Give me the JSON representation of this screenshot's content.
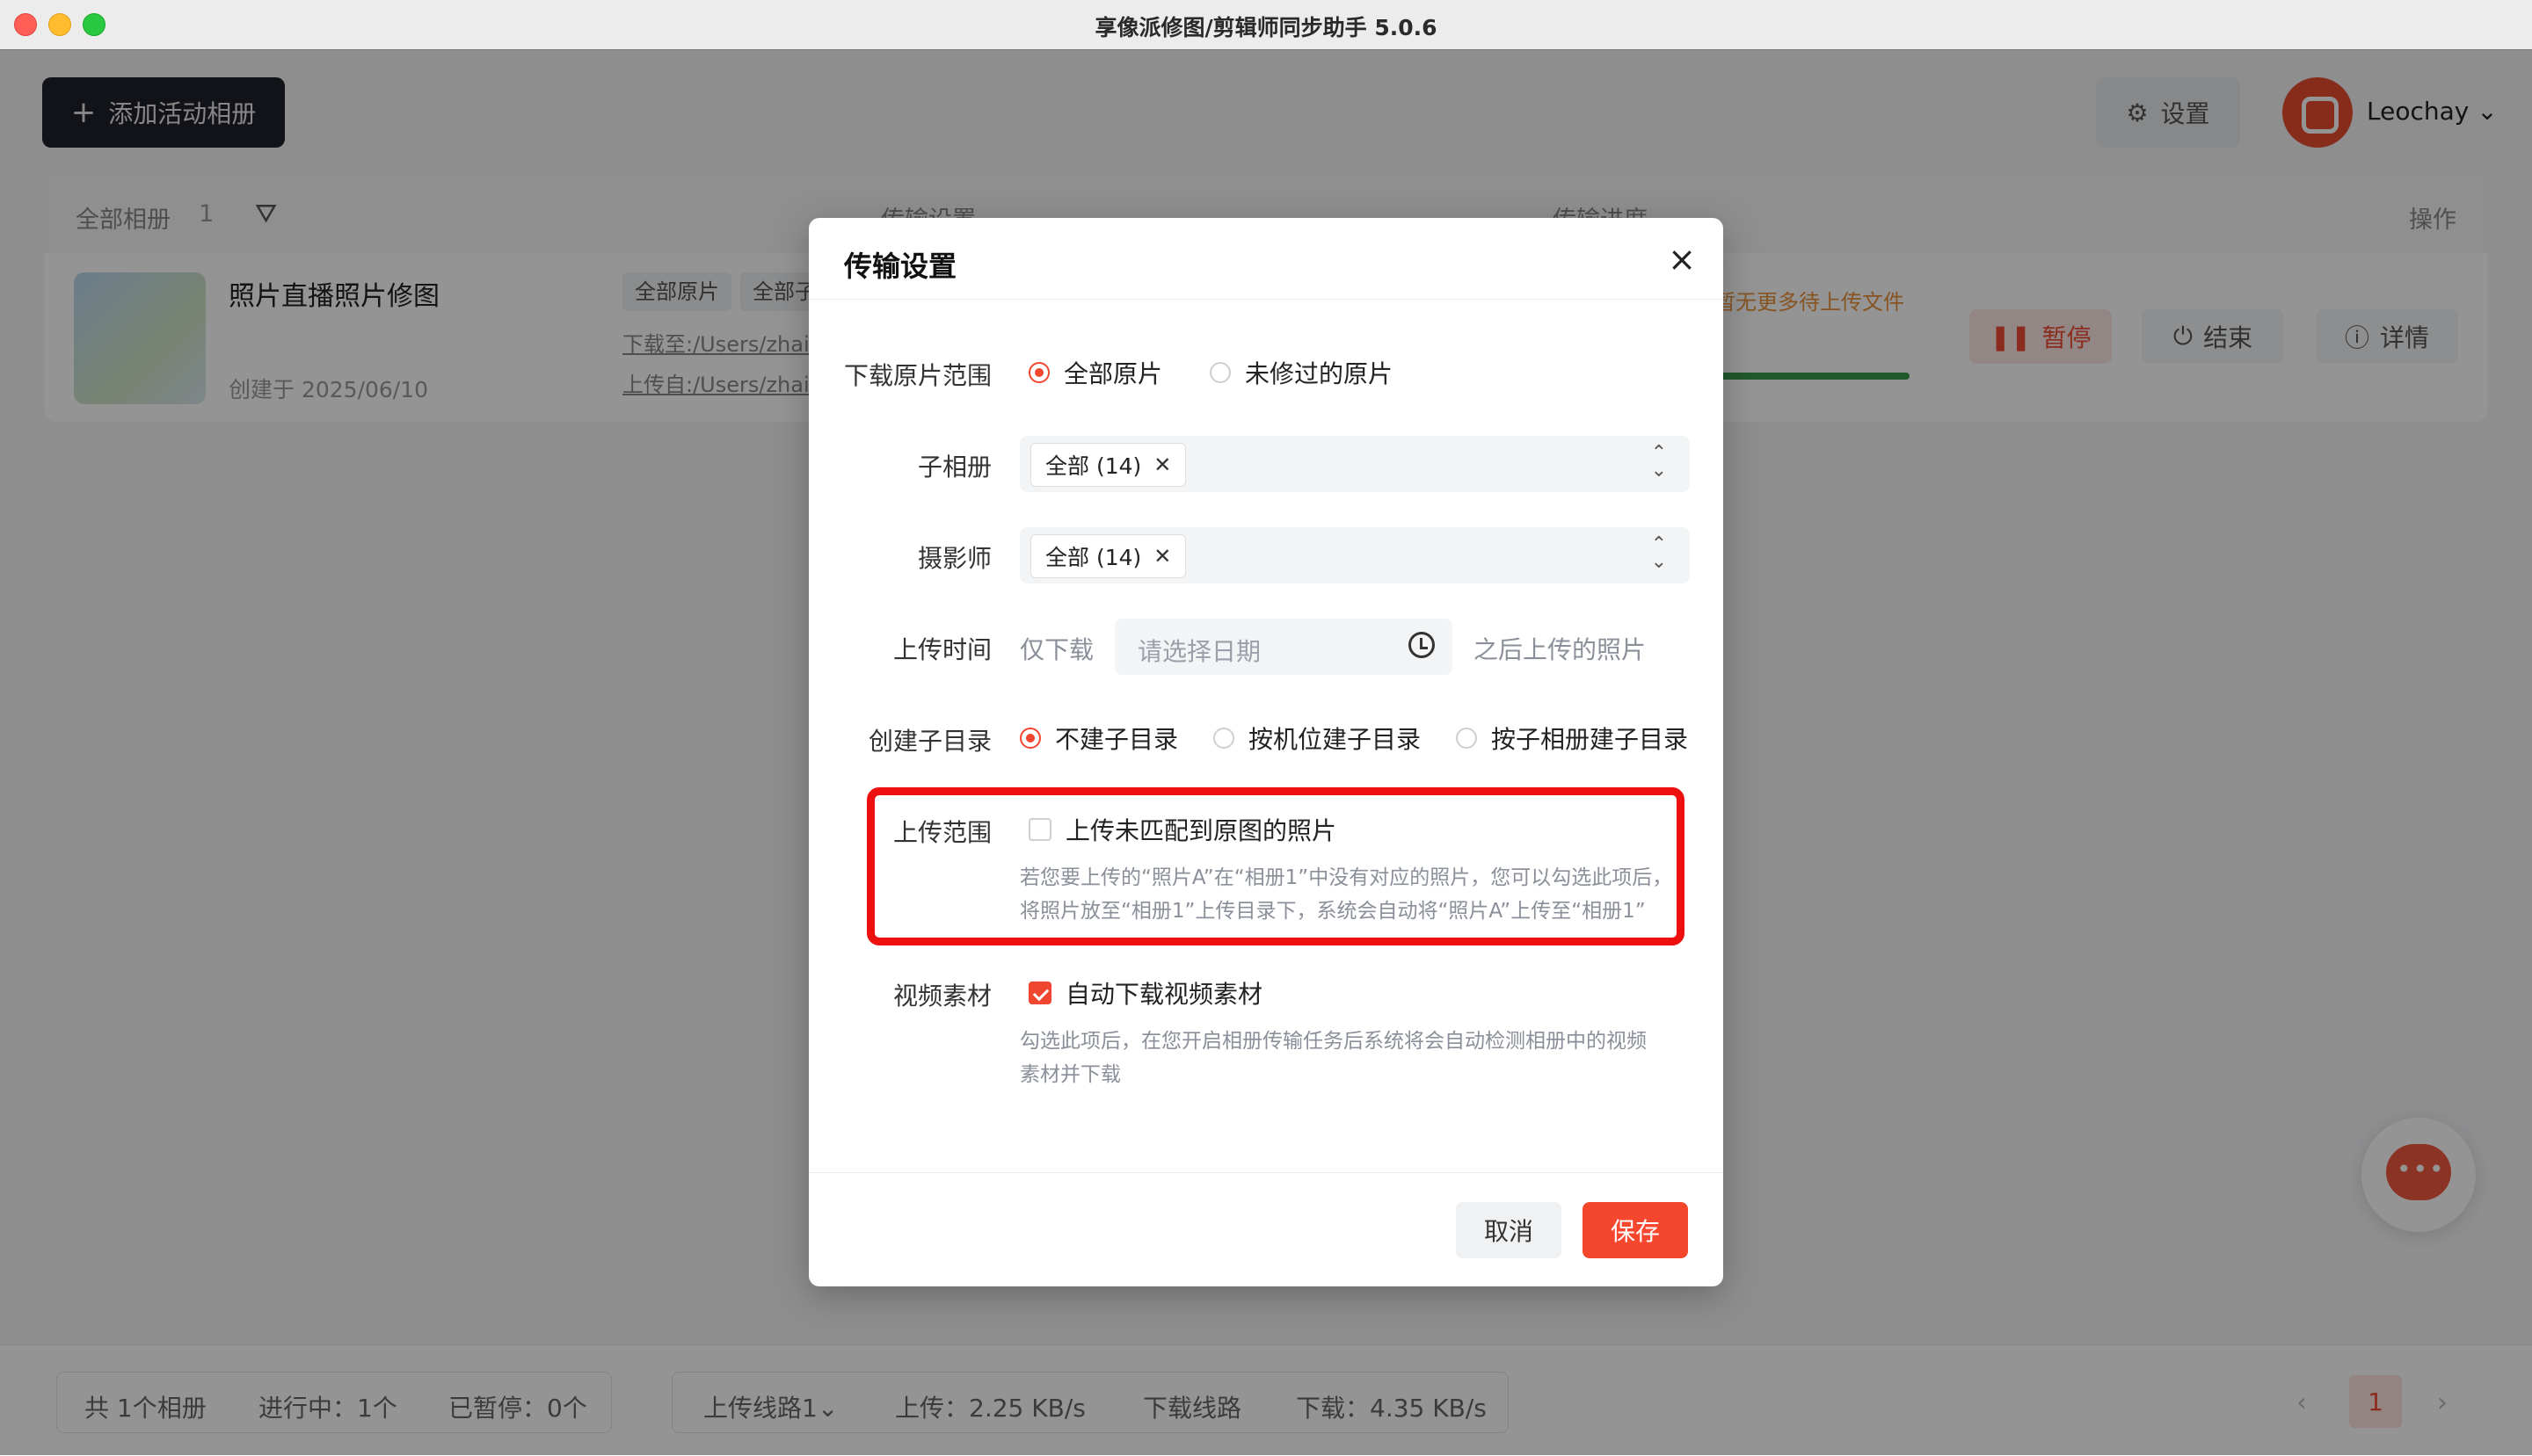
{
  "window": {
    "title": "享像派修图/剪辑师同步助手 5.0.6"
  },
  "toolbar": {
    "add_album_label": "添加活动相册",
    "settings_label": "设置",
    "username": "Leochay"
  },
  "table": {
    "header": {
      "all_albums": "全部相册",
      "count": "1",
      "col_transfer_settings": "传输设置",
      "col_transfer_progress": "传输进度",
      "col_actions": "操作"
    },
    "rows": [
      {
        "name": "照片直播照片修图",
        "created": "创建于 2025/06/10",
        "tag1": "全部原片",
        "tag2": "全部子",
        "download_path": "下载至:/Users/zhai",
        "upload_path": "上传自:/Users/zhai",
        "status_text": "暂无更多待上传文件",
        "progress": 1.0,
        "actions": {
          "pause": "暂停",
          "end": "结束",
          "detail": "详情"
        }
      }
    ]
  },
  "footer": {
    "total": "共 1个相册",
    "running": "进行中：1个",
    "paused": "已暂停：0个",
    "upload_line": "上传线路1",
    "upload_speed": "上传：2.25 KB/s",
    "download_line": "下载线路",
    "download_speed": "下载：4.35 KB/s",
    "page": "1"
  },
  "modal": {
    "title": "传输设置",
    "download_range": {
      "label": "下载原片范围",
      "options": [
        "全部原片",
        "未修过的原片"
      ],
      "selected": "全部原片"
    },
    "sub_album": {
      "label": "子相册",
      "chip": "全部 (14)"
    },
    "photographer": {
      "label": "摄影师",
      "chip": "全部 (14)"
    },
    "upload_time": {
      "label": "上传时间",
      "prefix": "仅下载",
      "placeholder": "请选择日期",
      "suffix": "之后上传的照片"
    },
    "subdir": {
      "label": "创建子目录",
      "options": [
        "不建子目录",
        "按机位建子目录",
        "按子相册建子目录"
      ],
      "selected": "不建子目录"
    },
    "upload_range": {
      "label": "上传范围",
      "checkbox_label": "上传未匹配到原图的照片",
      "checked": false,
      "help_line1": "若您要上传的“照片A”在“相册1”中没有对应的照片，您可以勾选此项后，",
      "help_line2": "将照片放至“相册1”上传目录下，系统会自动将“照片A”上传至“相册1”"
    },
    "video": {
      "label": "视频素材",
      "checkbox_label": "自动下载视频素材",
      "checked": true,
      "help_line1": "勾选此项后，在您开启相册传输任务后系统将会自动检测相册中的视频",
      "help_line2": "素材并下载"
    },
    "cancel_label": "取消",
    "save_label": "保存"
  },
  "colors": {
    "accent": "#f5472d",
    "highlight_border": "#ee0f0f",
    "progress": "#3a9a4a"
  }
}
